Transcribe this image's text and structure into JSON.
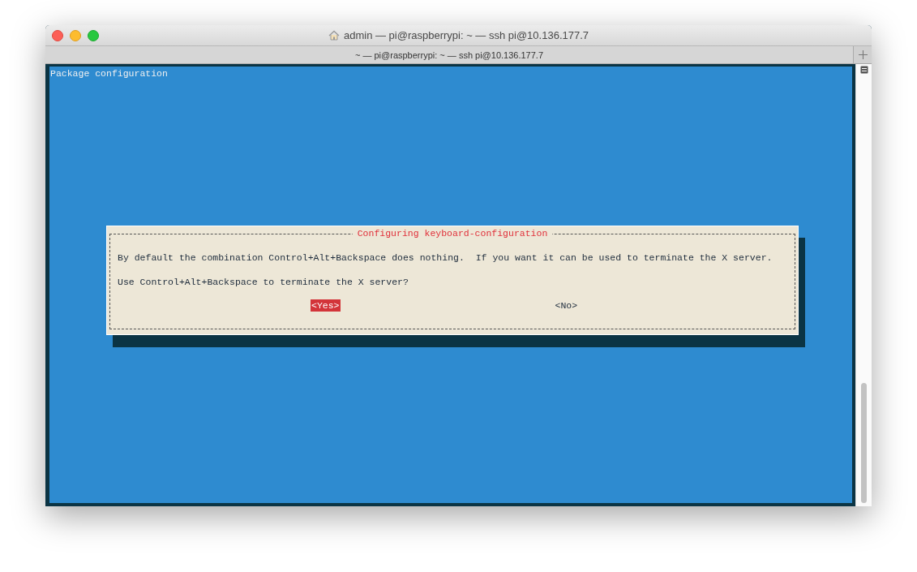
{
  "window": {
    "title": "admin — pi@raspberrypi: ~ — ssh pi@10.136.177.7"
  },
  "tab": {
    "title": "~ — pi@raspberrypi: ~ — ssh pi@10.136.177.7"
  },
  "terminal": {
    "header": "Package configuration"
  },
  "dialog": {
    "title": "Configuring keyboard-configuration",
    "lines": [
      "By default the combination Control+Alt+Backspace does nothing.  If you want it can be used to terminate the X server.",
      "Use Control+Alt+Backspace to terminate the X server?"
    ],
    "buttons": [
      {
        "label": "<Yes>",
        "selected": true
      },
      {
        "label": "<No>",
        "selected": false
      }
    ]
  }
}
